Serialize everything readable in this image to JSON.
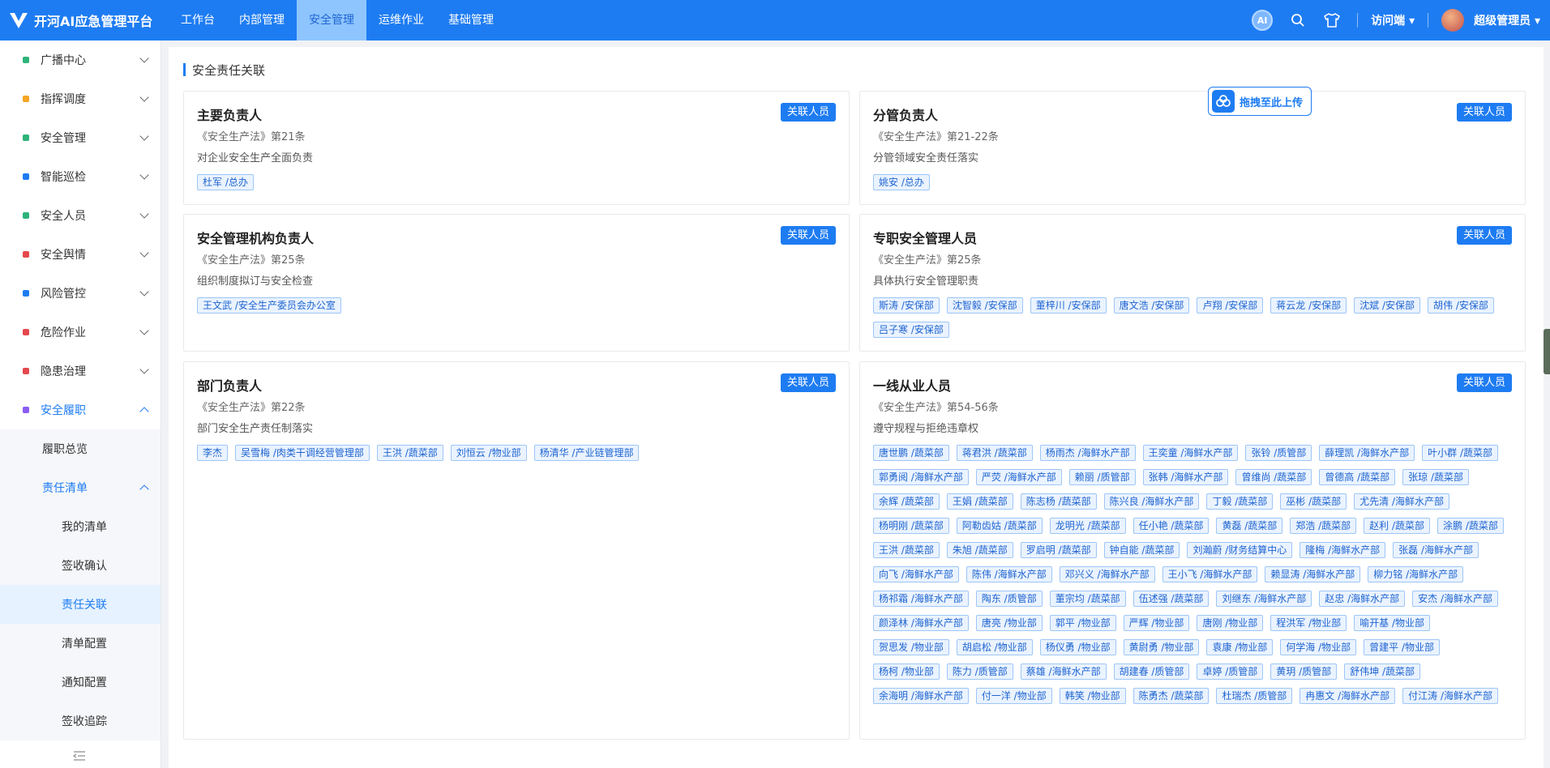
{
  "app": {
    "title": "开河AI应急管理平台"
  },
  "topnav": [
    {
      "label": "工作台",
      "active": false
    },
    {
      "label": "内部管理",
      "active": false
    },
    {
      "label": "安全管理",
      "active": true
    },
    {
      "label": "运维作业",
      "active": false
    },
    {
      "label": "基础管理",
      "active": false
    }
  ],
  "header": {
    "ai_label": "AI",
    "visitor_label": "访问端",
    "user_name": "超级管理员"
  },
  "sidebar": {
    "items": [
      {
        "label": "广播中心",
        "color": "#2db37a"
      },
      {
        "label": "指挥调度",
        "color": "#f5a623"
      },
      {
        "label": "安全管理",
        "color": "#2db37a"
      },
      {
        "label": "智能巡检",
        "color": "#1e7cf2"
      },
      {
        "label": "安全人员",
        "color": "#2db37a"
      },
      {
        "label": "安全舆情",
        "color": "#e5484d"
      },
      {
        "label": "风险管控",
        "color": "#1e7cf2"
      },
      {
        "label": "危险作业",
        "color": "#e5484d"
      },
      {
        "label": "隐患治理",
        "color": "#e5484d"
      },
      {
        "label": "安全履职",
        "color": "#8a5cf5"
      }
    ],
    "sub1_overview": "履职总览",
    "sub1_list": "责任清单",
    "sub2": [
      {
        "label": "我的清单",
        "active": false
      },
      {
        "label": "签收确认",
        "active": false
      },
      {
        "label": "责任关联",
        "active": true
      },
      {
        "label": "清单配置",
        "active": false
      },
      {
        "label": "通知配置",
        "active": false
      },
      {
        "label": "签收追踪",
        "active": false
      }
    ]
  },
  "page": {
    "title": "安全责任关联",
    "upload_label": "拖拽至此上传",
    "relate_button": "关联人员"
  },
  "cards": [
    {
      "title": "主要负责人",
      "law": "《安全生产法》第21条",
      "desc": "对企业安全生产全面负责",
      "tags": [
        "杜军 /总办"
      ]
    },
    {
      "title": "分管负责人",
      "law": "《安全生产法》第21-22条",
      "desc": "分管领域安全责任落实",
      "tags": [
        "姚安 /总办"
      ]
    },
    {
      "title": "安全管理机构负责人",
      "law": "《安全生产法》第25条",
      "desc": "组织制度拟订与安全检查",
      "tags": [
        "王文武 /安全生产委员会办公室"
      ]
    },
    {
      "title": "专职安全管理人员",
      "law": "《安全生产法》第25条",
      "desc": "具体执行安全管理职责",
      "tags": [
        "斯涛 /安保部",
        "沈智毅 /安保部",
        "董梓川 /安保部",
        "唐文浩 /安保部",
        "卢翔 /安保部",
        "蒋云龙 /安保部",
        "沈斌 /安保部",
        "胡伟 /安保部",
        "吕子寒 /安保部"
      ]
    },
    {
      "title": "部门负责人",
      "law": "《安全生产法》第22条",
      "desc": "部门安全生产责任制落实",
      "tags": [
        "李杰",
        "吴雪梅 /肉类干调经营管理部",
        "王洪 /蔬菜部",
        "刘恒云 /物业部",
        "杨清华 /产业链管理部"
      ]
    },
    {
      "title": "一线从业人员",
      "law": "《安全生产法》第54-56条",
      "desc": "遵守规程与拒绝违章权",
      "tags": [
        "唐世鹏 /蔬菜部",
        "蒋君洪 /蔬菜部",
        "杨雨杰 /海鲜水产部",
        "王奕童 /海鲜水产部",
        "张铃 /质管部",
        "薛理凯 /海鲜水产部",
        "叶小群 /蔬菜部",
        "郭勇阅 /海鲜水产部",
        "严荧 /海鲜水产部",
        "赖丽 /质管部",
        "张韩 /海鲜水产部",
        "曾维尚 /蔬菜部",
        "曾德高 /蔬菜部",
        "张琼 /蔬菜部",
        "余辉 /蔬菜部",
        "王娟 /蔬菜部",
        "陈志杨 /蔬菜部",
        "陈兴良 /海鲜水产部",
        "丁毅 /蔬菜部",
        "巫彬 /蔬菜部",
        "尤先清 /海鲜水产部",
        "杨明刚 /蔬菜部",
        "阿勒齿姑 /蔬菜部",
        "龙明光 /蔬菜部",
        "任小艳 /蔬菜部",
        "黄磊 /蔬菜部",
        "郑浩 /蔬菜部",
        "赵利 /蔬菜部",
        "涂鹏 /蔬菜部",
        "王洪 /蔬菜部",
        "朱旭 /蔬菜部",
        "罗启明 /蔬菜部",
        "钟自能 /蔬菜部",
        "刘瀚蔚 /财务结算中心",
        "隆梅 /海鲜水产部",
        "张磊 /海鲜水产部",
        "向飞 /海鲜水产部",
        "陈伟 /海鲜水产部",
        "邓兴义 /海鲜水产部",
        "王小飞 /海鲜水产部",
        "赖显涛 /海鲜水产部",
        "柳力铭 /海鲜水产部",
        "杨祁霜 /海鲜水产部",
        "陶东 /质管部",
        "董宗均 /蔬菜部",
        "伍述强 /蔬菜部",
        "刘继东 /海鲜水产部",
        "赵忠 /海鲜水产部",
        "安杰 /海鲜水产部",
        "颜泽林 /海鲜水产部",
        "唐亮 /物业部",
        "郭平 /物业部",
        "严辉 /物业部",
        "唐刚 /物业部",
        "程洪军 /物业部",
        "喻开基 /物业部",
        "贺思发 /物业部",
        "胡启松 /物业部",
        "杨仪勇 /物业部",
        "黄尉勇 /物业部",
        "袁康 /物业部",
        "何学海 /物业部",
        "曾建平 /物业部",
        "杨柯 /物业部",
        "陈力 /质管部",
        "蔡雄 /海鲜水产部",
        "胡建春 /质管部",
        "卓婷 /质管部",
        "黄玥 /质管部",
        "舒伟坤 /蔬菜部",
        "余海明 /海鲜水产部",
        "付一洋 /物业部",
        "韩笑 /物业部",
        "陈勇杰 /蔬菜部",
        "杜瑞杰 /质管部",
        "冉惠文 /海鲜水产部",
        "付江涛 /海鲜水产部"
      ]
    }
  ]
}
